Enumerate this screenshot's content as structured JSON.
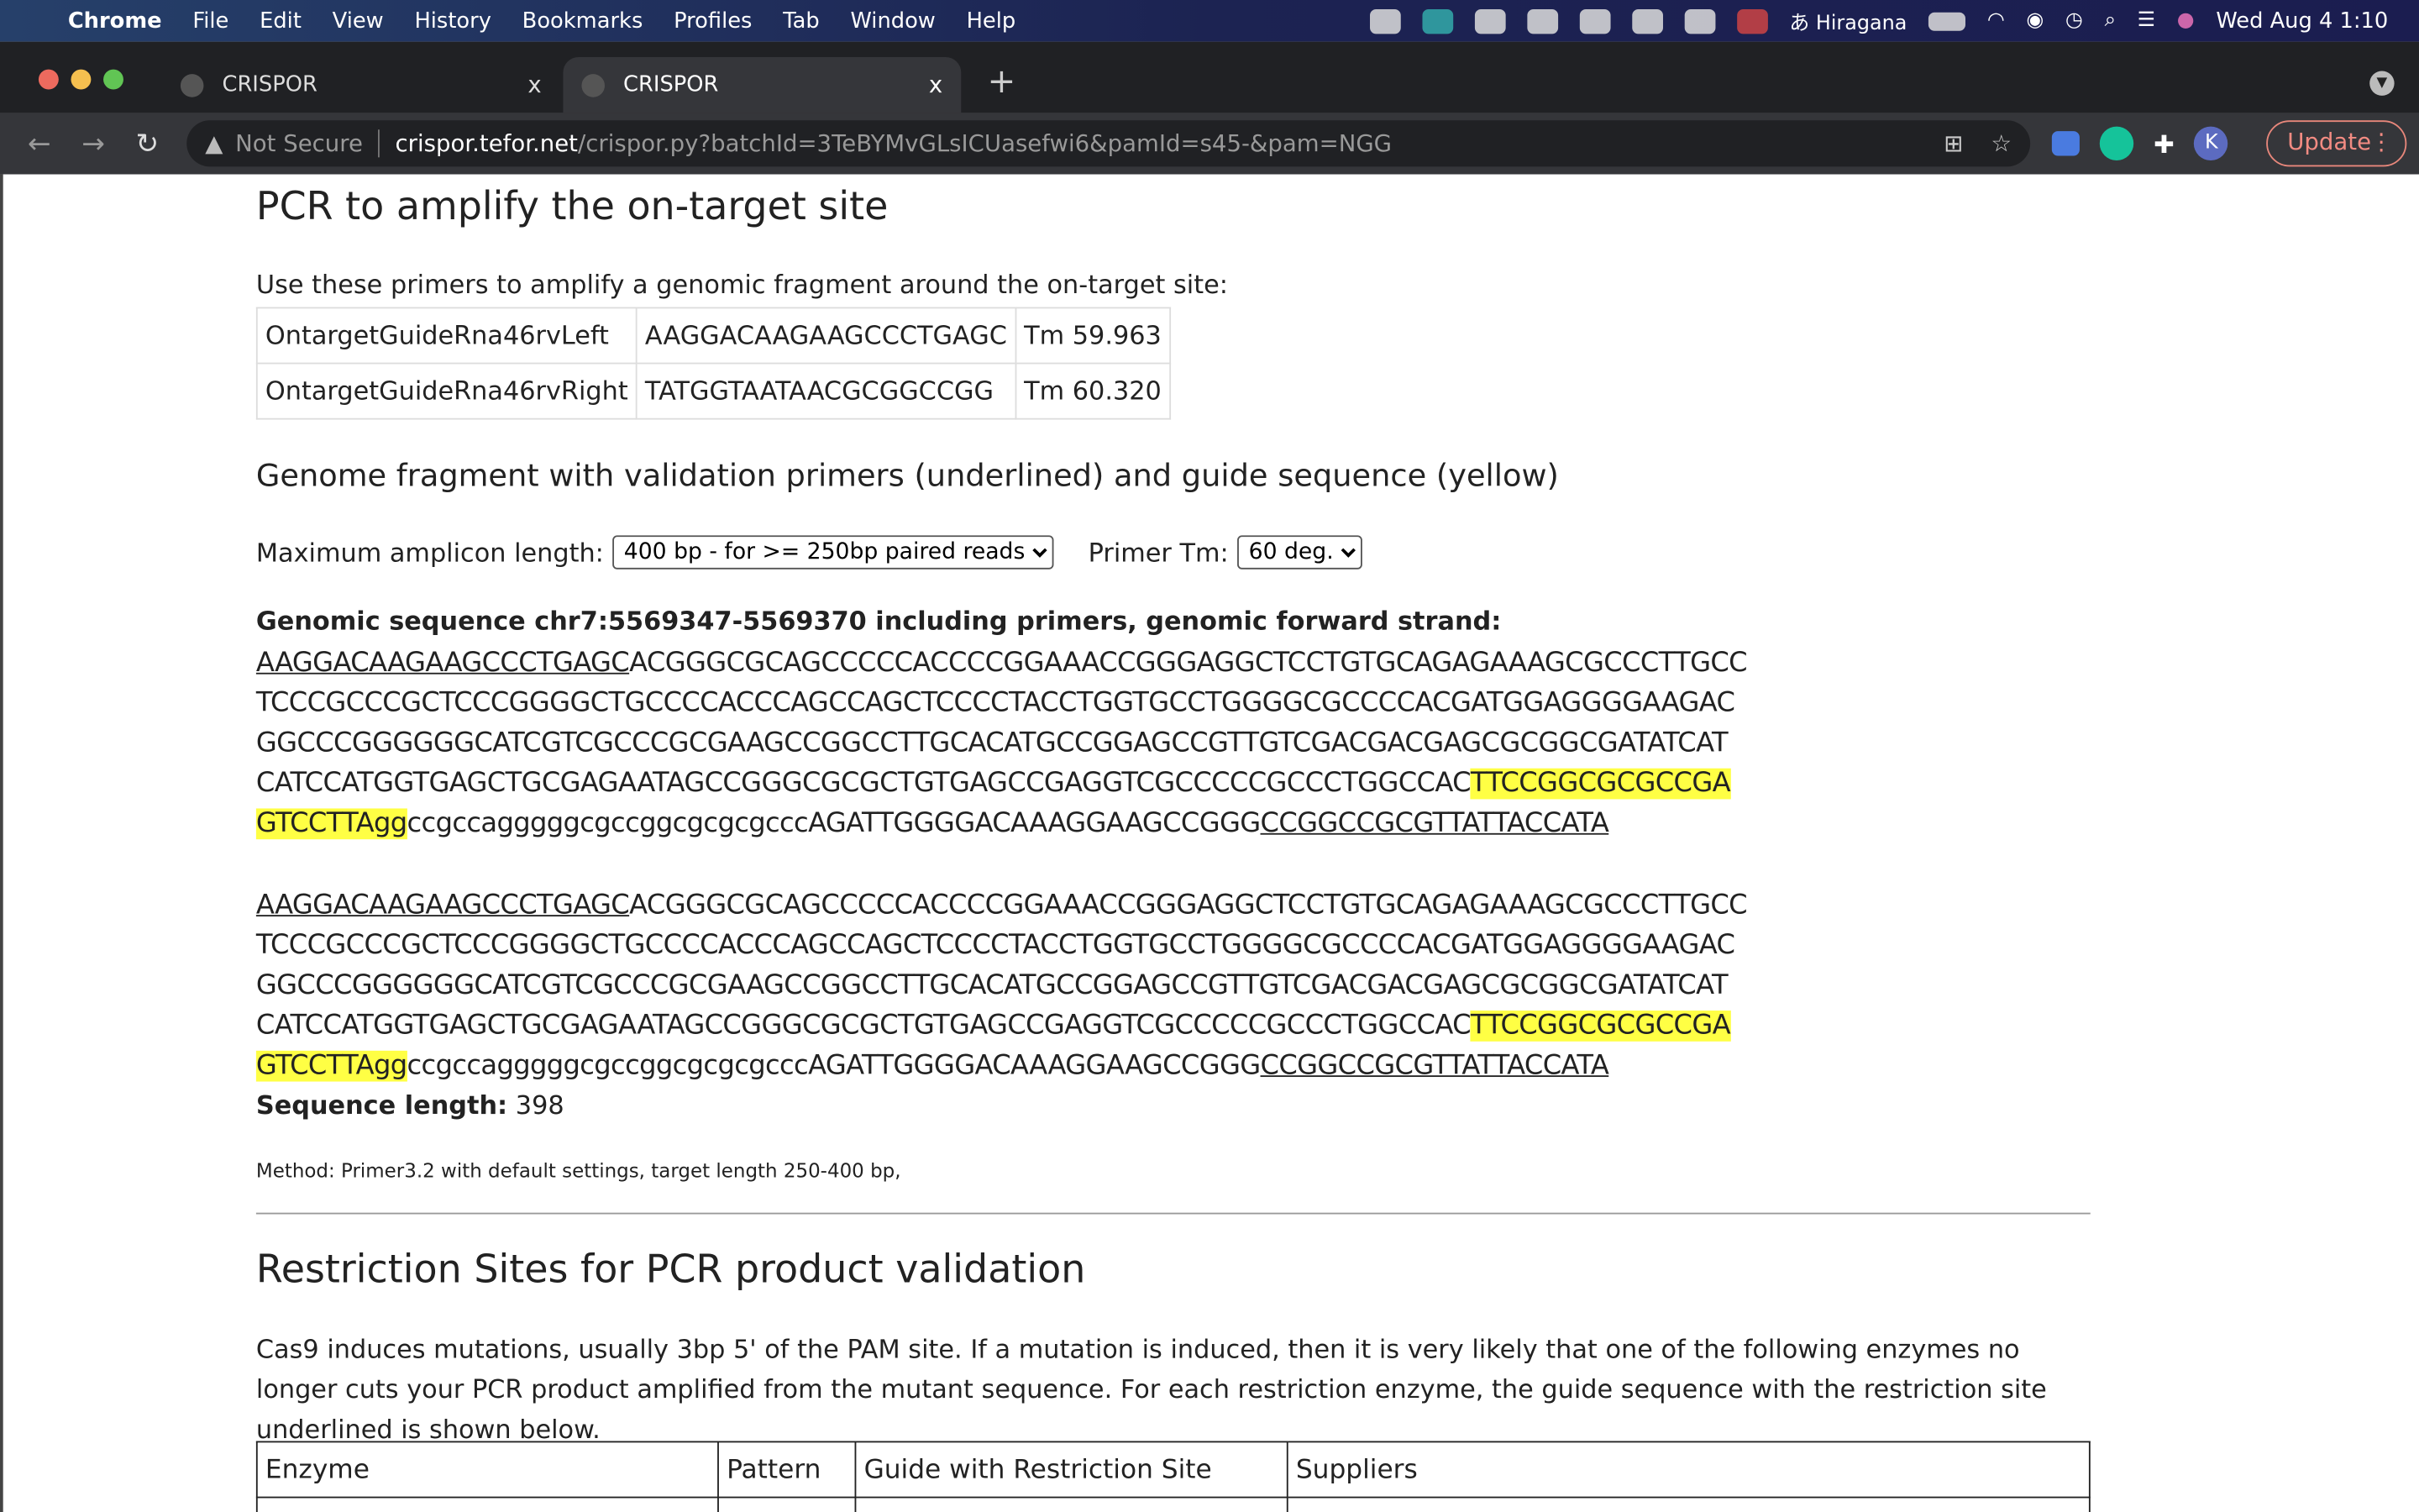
{
  "menubar": {
    "app": "Chrome",
    "items": [
      "File",
      "Edit",
      "View",
      "History",
      "Bookmarks",
      "Profiles",
      "Tab",
      "Window",
      "Help"
    ],
    "input_method": "Hiragana",
    "clock": "Wed Aug 4  1:10"
  },
  "tabs": [
    {
      "title": "CRISPOR",
      "close": "x"
    },
    {
      "title": "CRISPOR",
      "close": "x"
    }
  ],
  "address": {
    "security": "Not Secure",
    "host": "crispor.tefor.net",
    "path": "/crispor.py?batchId=3TeBYMvGLsICUasefwi6&pamId=s45-&pam=NGG"
  },
  "toolbar": {
    "profile_initial": "K",
    "update_label": "Update"
  },
  "pcr": {
    "title": "PCR to amplify the on-target site",
    "intro": "Use these primers to amplify a genomic fragment around the on-target site:",
    "primers": [
      {
        "name": "OntargetGuideRna46rvLeft",
        "seq": "AAGGACAAGAAGCCCTGAGC",
        "tm": "Tm 59.963"
      },
      {
        "name": "OntargetGuideRna46rvRight",
        "seq": "TATGGTAATAACGCGGCCGG",
        "tm": "Tm 60.320"
      }
    ]
  },
  "fragment": {
    "title": "Genome fragment with validation primers (underlined) and guide sequence (yellow)",
    "amplicon_label": "Maximum amplicon length:",
    "amplicon_value": "400 bp - for >= 250bp paired reads",
    "tm_label": "Primer Tm:",
    "tm_value": "60 deg.",
    "genomic_label": "Genomic sequence chr7:5569347-5569370 including primers, genomic forward strand:",
    "lines": [
      [
        {
          "t": "AAGGACAAGAAGCCCTGAGC",
          "s": "u"
        },
        {
          "t": "ACGGGCGCAGCCCCCACCCCGGAAACCGGGAGGCTCCTGTGCAGAGAAAGCGCCCTTGCC",
          "s": "n"
        }
      ],
      [
        {
          "t": "TCCCGCCCGCTCCCGGGGCTGCCCCACCCAGCCAGCTCCCCTACCTGGTGCCTGGGGCGCCCCACGATGGAGGGGAAGAC",
          "s": "n"
        }
      ],
      [
        {
          "t": "GGCCCGGGGGGCATCGTCGCCCGCGAAGCCGGCCTTGCACATGCCGGAGCCGTTGTCGACGACGAGCGCGGCGATATCAT",
          "s": "n"
        }
      ],
      [
        {
          "t": "CATCCATGGTGAGCTGCGAGAATAGCCGGGCGCGCTGTGAGCCGAGGTCGCCCCCGCCCTGGCCAC",
          "s": "n"
        },
        {
          "t": "TTCCGGCGCGCCGA",
          "s": "h"
        }
      ],
      [
        {
          "t": "GTCCTTAgg",
          "s": "h"
        },
        {
          "t": "ccgccagggggcgccggcgcgcgcccAGATTGGGGACAAAGGAAGCCGGG",
          "s": "n"
        },
        {
          "t": "CCGGCCGCGTTATTACCATA",
          "s": "u"
        }
      ]
    ],
    "length_label": "Sequence length:",
    "length_value": "398",
    "method": "Method: Primer3.2 with default settings, target length 250-400 bp,"
  },
  "restriction": {
    "title": "Restriction Sites for PCR product validation",
    "text": "Cas9 induces mutations, usually 3bp 5' of the PAM site. If a mutation is induced, then it is very likely that one of the following enzymes no longer cuts your PCR product amplified from the mutant sequence. For each restriction enzyme, the guide sequence with the restriction site underlined is shown below.",
    "headers": [
      "Enzyme",
      "Pattern",
      "Guide with Restriction Site",
      "Suppliers"
    ]
  },
  "colors": {
    "highlight": "#ffff44",
    "update": "#f28b82"
  }
}
